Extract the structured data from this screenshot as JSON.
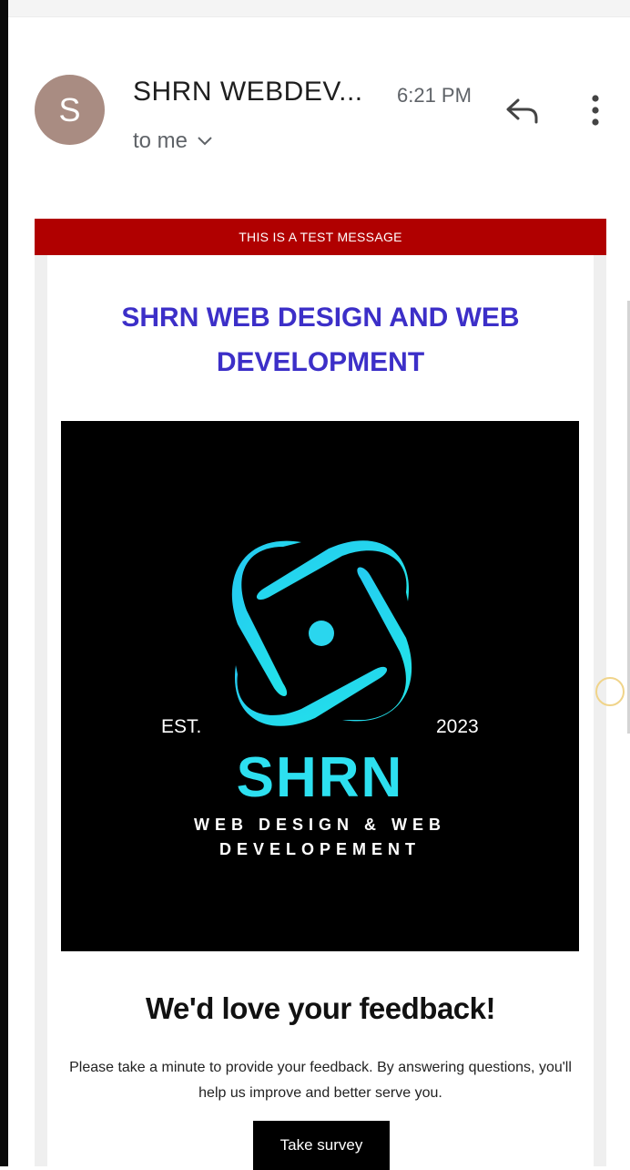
{
  "header": {
    "avatar_initial": "S",
    "sender": "SHRN WEBDEV...",
    "time": "6:21 PM",
    "recipient": "to me",
    "icons": {
      "reply": "reply-icon",
      "more": "more-vert-icon",
      "expand": "chevron-down-icon"
    }
  },
  "email": {
    "banner": "THIS IS A TEST MESSAGE",
    "headline": "SHRN WEB DESIGN AND WEB DEVELOPMENT",
    "logo": {
      "est": "EST.",
      "year": "2023",
      "brand": "SHRN",
      "tagline_line1": "WEB DESIGN & WEB",
      "tagline_line2": "DEVELOPEMENT"
    },
    "feedback_title": "We'd love your feedback!",
    "feedback_body": "Please take a minute to provide your feedback. By answering questions, you'll help us improve and better serve you.",
    "survey_button": "Take survey"
  },
  "colors": {
    "banner": "#b00000",
    "headline": "#3c2fc8",
    "logo_accent": "#2de0f0",
    "avatar": "#a98c82"
  }
}
